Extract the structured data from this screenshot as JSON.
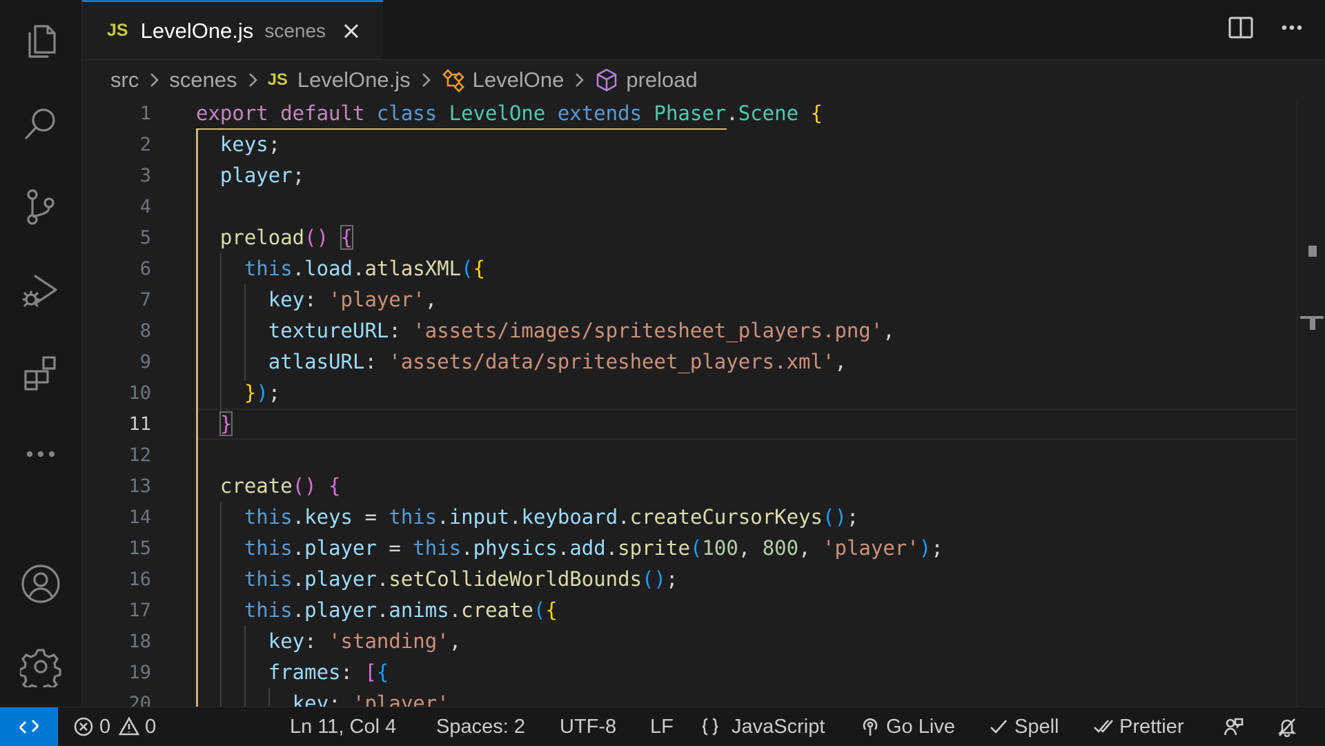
{
  "activity_bar": [
    "files-icon",
    "search-icon",
    "source-control-icon",
    "run-debug-icon",
    "extensions-icon",
    "more-icon",
    "account-icon",
    "settings-gear-icon"
  ],
  "tab": {
    "badge": "JS",
    "filename": "LevelOne.js",
    "folder": "scenes"
  },
  "breadcrumb": {
    "src": "src",
    "scenes": "scenes",
    "badge": "JS",
    "file": "LevelOne.js",
    "class": "LevelOne",
    "method": "preload"
  },
  "editor": {
    "active_line": 11,
    "line_numbers": [
      "1",
      "2",
      "3",
      "4",
      "5",
      "6",
      "7",
      "8",
      "9",
      "10",
      "11",
      "12",
      "13",
      "14",
      "15",
      "16",
      "17",
      "18",
      "19",
      "20"
    ],
    "lines": [
      [
        [
          "k",
          "export "
        ],
        [
          "k",
          "default "
        ],
        [
          "b",
          "class "
        ],
        [
          "t",
          "LevelOne "
        ],
        [
          "b",
          "extends "
        ],
        [
          "t",
          "Phaser"
        ],
        [
          "p",
          "."
        ],
        [
          "t",
          "Scene "
        ],
        [
          "br1",
          "{"
        ]
      ],
      [
        [
          "p",
          "  "
        ],
        [
          "v",
          "keys"
        ],
        [
          "p",
          ";"
        ]
      ],
      [
        [
          "p",
          "  "
        ],
        [
          "v",
          "player"
        ],
        [
          "p",
          ";"
        ]
      ],
      [],
      [
        [
          "p",
          "  "
        ],
        [
          "f",
          "preload"
        ],
        [
          "br2",
          "()"
        ],
        [
          "p",
          " "
        ],
        [
          "br2x",
          "{"
        ]
      ],
      [
        [
          "p",
          "    "
        ],
        [
          "b",
          "this"
        ],
        [
          "p",
          "."
        ],
        [
          "v",
          "load"
        ],
        [
          "p",
          "."
        ],
        [
          "f",
          "atlasXML"
        ],
        [
          "br3",
          "("
        ],
        [
          "br1",
          "{"
        ]
      ],
      [
        [
          "p",
          "      "
        ],
        [
          "v",
          "key"
        ],
        [
          "p",
          ": "
        ],
        [
          "s",
          "'player'"
        ],
        [
          "p",
          ","
        ]
      ],
      [
        [
          "p",
          "      "
        ],
        [
          "v",
          "textureURL"
        ],
        [
          "p",
          ": "
        ],
        [
          "s",
          "'assets/images/spritesheet_players.png'"
        ],
        [
          "p",
          ","
        ]
      ],
      [
        [
          "p",
          "      "
        ],
        [
          "v",
          "atlasURL"
        ],
        [
          "p",
          ": "
        ],
        [
          "s",
          "'assets/data/spritesheet_players.xml'"
        ],
        [
          "p",
          ","
        ]
      ],
      [
        [
          "p",
          "    "
        ],
        [
          "br1",
          "}"
        ],
        [
          "br3",
          ")"
        ],
        [
          "p",
          ";"
        ]
      ],
      [
        [
          "p",
          "  "
        ],
        [
          "br2x",
          "}"
        ]
      ],
      [],
      [
        [
          "p",
          "  "
        ],
        [
          "f",
          "create"
        ],
        [
          "br2",
          "()"
        ],
        [
          "p",
          " "
        ],
        [
          "br2",
          "{"
        ]
      ],
      [
        [
          "p",
          "    "
        ],
        [
          "b",
          "this"
        ],
        [
          "p",
          "."
        ],
        [
          "v",
          "keys"
        ],
        [
          "p",
          " = "
        ],
        [
          "b",
          "this"
        ],
        [
          "p",
          "."
        ],
        [
          "v",
          "input"
        ],
        [
          "p",
          "."
        ],
        [
          "v",
          "keyboard"
        ],
        [
          "p",
          "."
        ],
        [
          "f",
          "createCursorKeys"
        ],
        [
          "br3",
          "()"
        ],
        [
          "p",
          ";"
        ]
      ],
      [
        [
          "p",
          "    "
        ],
        [
          "b",
          "this"
        ],
        [
          "p",
          "."
        ],
        [
          "v",
          "player"
        ],
        [
          "p",
          " = "
        ],
        [
          "b",
          "this"
        ],
        [
          "p",
          "."
        ],
        [
          "v",
          "physics"
        ],
        [
          "p",
          "."
        ],
        [
          "v",
          "add"
        ],
        [
          "p",
          "."
        ],
        [
          "f",
          "sprite"
        ],
        [
          "br3",
          "("
        ],
        [
          "n",
          "100"
        ],
        [
          "p",
          ", "
        ],
        [
          "n",
          "800"
        ],
        [
          "p",
          ", "
        ],
        [
          "s",
          "'player'"
        ],
        [
          "br3",
          ")"
        ],
        [
          "p",
          ";"
        ]
      ],
      [
        [
          "p",
          "    "
        ],
        [
          "b",
          "this"
        ],
        [
          "p",
          "."
        ],
        [
          "v",
          "player"
        ],
        [
          "p",
          "."
        ],
        [
          "f",
          "setCollideWorldBounds"
        ],
        [
          "br3",
          "()"
        ],
        [
          "p",
          ";"
        ]
      ],
      [
        [
          "p",
          "    "
        ],
        [
          "b",
          "this"
        ],
        [
          "p",
          "."
        ],
        [
          "v",
          "player"
        ],
        [
          "p",
          "."
        ],
        [
          "v",
          "anims"
        ],
        [
          "p",
          "."
        ],
        [
          "f",
          "create"
        ],
        [
          "br3",
          "("
        ],
        [
          "br1",
          "{"
        ]
      ],
      [
        [
          "p",
          "      "
        ],
        [
          "v",
          "key"
        ],
        [
          "p",
          ": "
        ],
        [
          "s",
          "'standing'"
        ],
        [
          "p",
          ","
        ]
      ],
      [
        [
          "p",
          "      "
        ],
        [
          "v",
          "frames"
        ],
        [
          "p",
          ": "
        ],
        [
          "br2",
          "["
        ],
        [
          "br3",
          "{"
        ]
      ],
      [
        [
          "p",
          "        "
        ],
        [
          "v",
          "key"
        ],
        [
          "p",
          ": "
        ],
        [
          "s",
          "'player'"
        ],
        [
          "p",
          ","
        ]
      ]
    ]
  },
  "status": {
    "errors": "0",
    "warnings": "0",
    "position": "Ln 11, Col 4",
    "spaces": "Spaces: 2",
    "encoding": "UTF-8",
    "eol": "LF",
    "language": "JavaScript",
    "go_live": "Go Live",
    "spell": "Spell",
    "prettier": "Prettier"
  }
}
